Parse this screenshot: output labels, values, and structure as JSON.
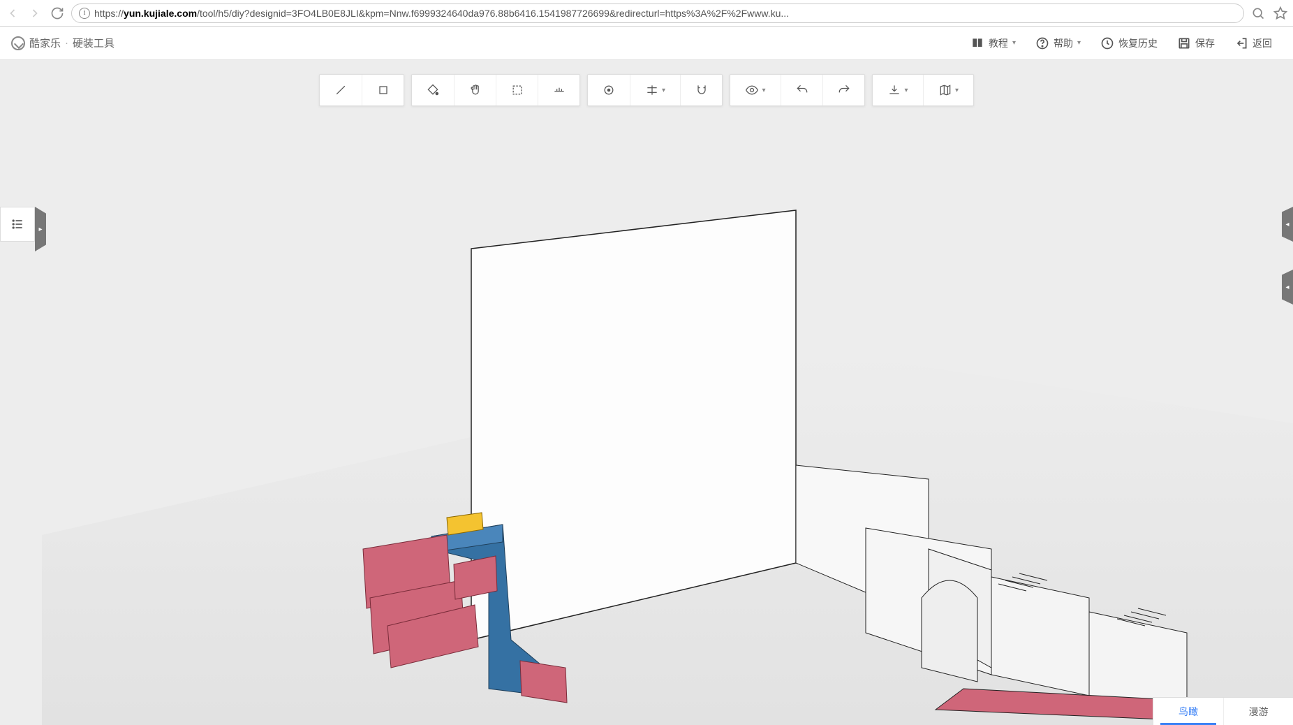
{
  "browser": {
    "url": "https://yun.kujiale.com/tool/h5/diy?designid=3FO4LB0E8JLI&kpm=Nnw.f6999324640da976.88b6416.1541987726699&redirecturl=https%3A%2F%2Fwww.ku...",
    "url_host_prefix": "https://",
    "url_host": "yun.kujiale.com",
    "url_rest": "/tool/h5/diy?designid=3FO4LB0E8JLI&kpm=Nnw.f6999324640da976.88b6416.1541987726699&redirecturl=https%3A%2F%2Fwww.ku..."
  },
  "brand": {
    "name": "酷家乐",
    "separator": "·",
    "subtitle": "硬装工具"
  },
  "header_actions": {
    "tutorial": "教程",
    "help": "帮助",
    "restore": "恢复历史",
    "save": "保存",
    "back": "返回"
  },
  "toolbar": {
    "line": "line",
    "rect": "rect",
    "fill": "fill",
    "hand": "hand",
    "select_area": "select-area",
    "horizon": "horizon",
    "target": "target",
    "align": "align",
    "snap": "snap",
    "eye": "eye",
    "undo": "undo",
    "redo": "redo",
    "download": "download",
    "map": "map"
  },
  "bottom_tabs": {
    "bird_view": "鸟瞰",
    "roam": "漫游"
  }
}
